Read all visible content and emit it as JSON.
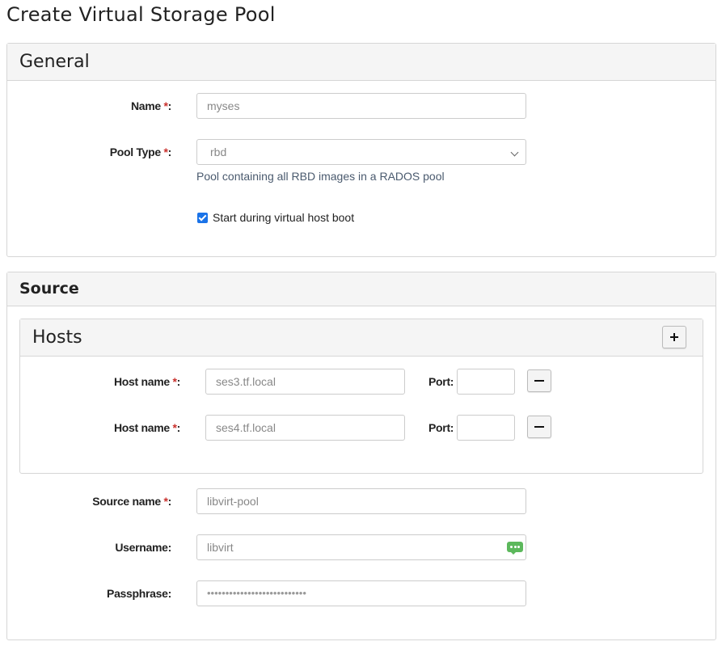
{
  "page": {
    "title": "Create Virtual Storage Pool"
  },
  "general": {
    "title": "General",
    "name_label": "Name ",
    "name_value": "myses",
    "pool_type_label": "Pool Type ",
    "pool_type_value": "rbd",
    "pool_type_help": "Pool containing all RBD images in a RADOS pool",
    "autostart_label": "Start during virtual host boot",
    "autostart_checked": true
  },
  "source": {
    "title": "Source",
    "hosts": {
      "title": "Hosts",
      "host_label": "Host name ",
      "port_label": "Port:",
      "items": [
        {
          "host": "ses3.tf.local",
          "port": ""
        },
        {
          "host": "ses4.tf.local",
          "port": ""
        }
      ]
    },
    "source_name_label": "Source name ",
    "source_name_value": "libvirt-pool",
    "username_label": "Username:",
    "username_value": "libvirt",
    "passphrase_label": "Passphrase:",
    "passphrase_value": "•••••••••••••••••••••••••••"
  },
  "common": {
    "required_mark": "*",
    "colon": ":"
  },
  "icons": {
    "add": "plus-icon",
    "remove": "minus-icon",
    "select": "chevron-down-icon",
    "password_manager": "chat-dots-icon"
  },
  "colors": {
    "required": "#c9302c",
    "checkbox": "#1a73e8",
    "help_text": "#4a5a6e",
    "icon_green": "#5cb85c"
  }
}
